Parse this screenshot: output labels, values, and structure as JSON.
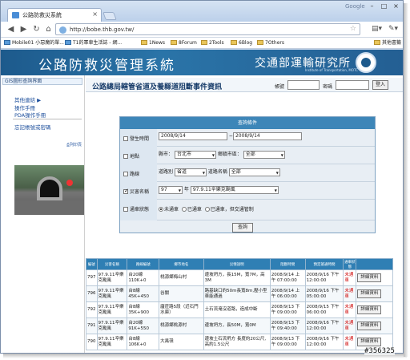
{
  "browser": {
    "tab_title": "公路防救災系統",
    "google": "Google",
    "url": "http://bobe.thb.gov.tw/"
  },
  "bookmarks": [
    {
      "label": "Mobile01 小惡魔的單...",
      "site": true
    },
    {
      "label": "T1的軍車生活誌 - 網...",
      "site": true
    },
    {
      "label": "1News"
    },
    {
      "label": "8Forum"
    },
    {
      "label": "2Tools"
    },
    {
      "label": "6Blog"
    },
    {
      "label": "7Others"
    },
    {
      "label": "其他書籤"
    }
  ],
  "banner": {
    "title": "公路防救災管理系統",
    "org": "交通部運輸研究所",
    "org_en": "Institute of Transportation, MOTC"
  },
  "sidebar": {
    "current": "GIS圖形查詢界面",
    "links": [
      "其他連結",
      "操作手冊",
      "PDA操作手冊",
      "忘記帳號或密碼"
    ],
    "print": "列印頁"
  },
  "header": {
    "title": "公路總局轄管省道及養縣道阻斷事件資訊",
    "account_label": "帳號",
    "password_label": "密碼",
    "login_label": "登入"
  },
  "query": {
    "title": "查詢條件",
    "date": {
      "label": "發生時間",
      "from": "2008/9/14",
      "sep": "~",
      "to": "2008/9/14"
    },
    "area": {
      "label": "地點",
      "county_label": "縣市：",
      "county": "台北市",
      "town_label": "鄉鎮市區：",
      "town": "全部"
    },
    "road": {
      "label": "路線",
      "class_label": "道路別",
      "class": "省道",
      "name_label": "道路名稱",
      "name": "全部"
    },
    "disaster": {
      "label": "災害名稱",
      "year": "97",
      "year_suffix": "年",
      "name": "97.9.11辛樂克颱風"
    },
    "status": {
      "label": "通車狀態",
      "options": [
        "未通車",
        "已通車",
        "已通車，但交通管制"
      ]
    },
    "submit": "查詢"
  },
  "results": {
    "headers": [
      "編號",
      "災害名稱",
      "路線編號",
      "鄉市地名",
      "災情說明",
      "阻斷時間",
      "預定搶通時間",
      "通車狀態",
      ""
    ],
    "rows": [
      {
        "id": "797",
        "disaster": "97.9.11辛樂克颱風",
        "route": "台20線 110K+0",
        "place": "桃源鄉梅山村",
        "desc": "邊坡坍方，長15M，寬7M，高3M",
        "blocked": "2008/9/14 上午 07:00:00",
        "eta": "2008/9/16 下午 12:00:00",
        "status": "未通車",
        "action": "詳細資料"
      },
      {
        "id": "796",
        "disaster": "97.9.11辛樂克颱風",
        "route": "台8線 45K+450",
        "place": "谷關",
        "desc": "路基缺口約50m長寬8m,壓小型車能通過",
        "blocked": "2008/9/14 上午 06:00:00",
        "eta": "2008/9/16 下午 05:00:00",
        "status": "未通車",
        "action": "詳細資料"
      },
      {
        "id": "792",
        "disaster": "97.9.11辛樂克颱風",
        "route": "台8線 35K+900",
        "place": "廬莊路5段（近石門水庫）",
        "desc": "土石流淹沒道路，造成中斷",
        "blocked": "2008/9/13 下午 09:00:00",
        "eta": "2008/9/15 下午 06:00:00",
        "status": "未通車",
        "action": "詳細資料"
      },
      {
        "id": "791",
        "disaster": "97.9.11辛樂克颱風",
        "route": "台20線 91K+550",
        "place": "桃源鄉桃源村",
        "desc": "邊坡坍方，長50M，寬0M",
        "blocked": "2008/9/13 下午 09:40:00",
        "eta": "2008/9/16 下午 12:00:00",
        "status": "未通車",
        "action": "詳細資料"
      },
      {
        "id": "790",
        "disaster": "97.9.11辛樂克颱風",
        "route": "台8線 106K+0",
        "place": "大禹嶺",
        "desc": "邊坡土石流坍方 長度約20公尺,高約1.5公尺",
        "blocked": "2008/9/13 下午 09:00:00",
        "eta": "2008/9/16 下午 12:00:00",
        "status": "未通車",
        "action": "詳細資料"
      }
    ]
  },
  "watermark": "#356325"
}
